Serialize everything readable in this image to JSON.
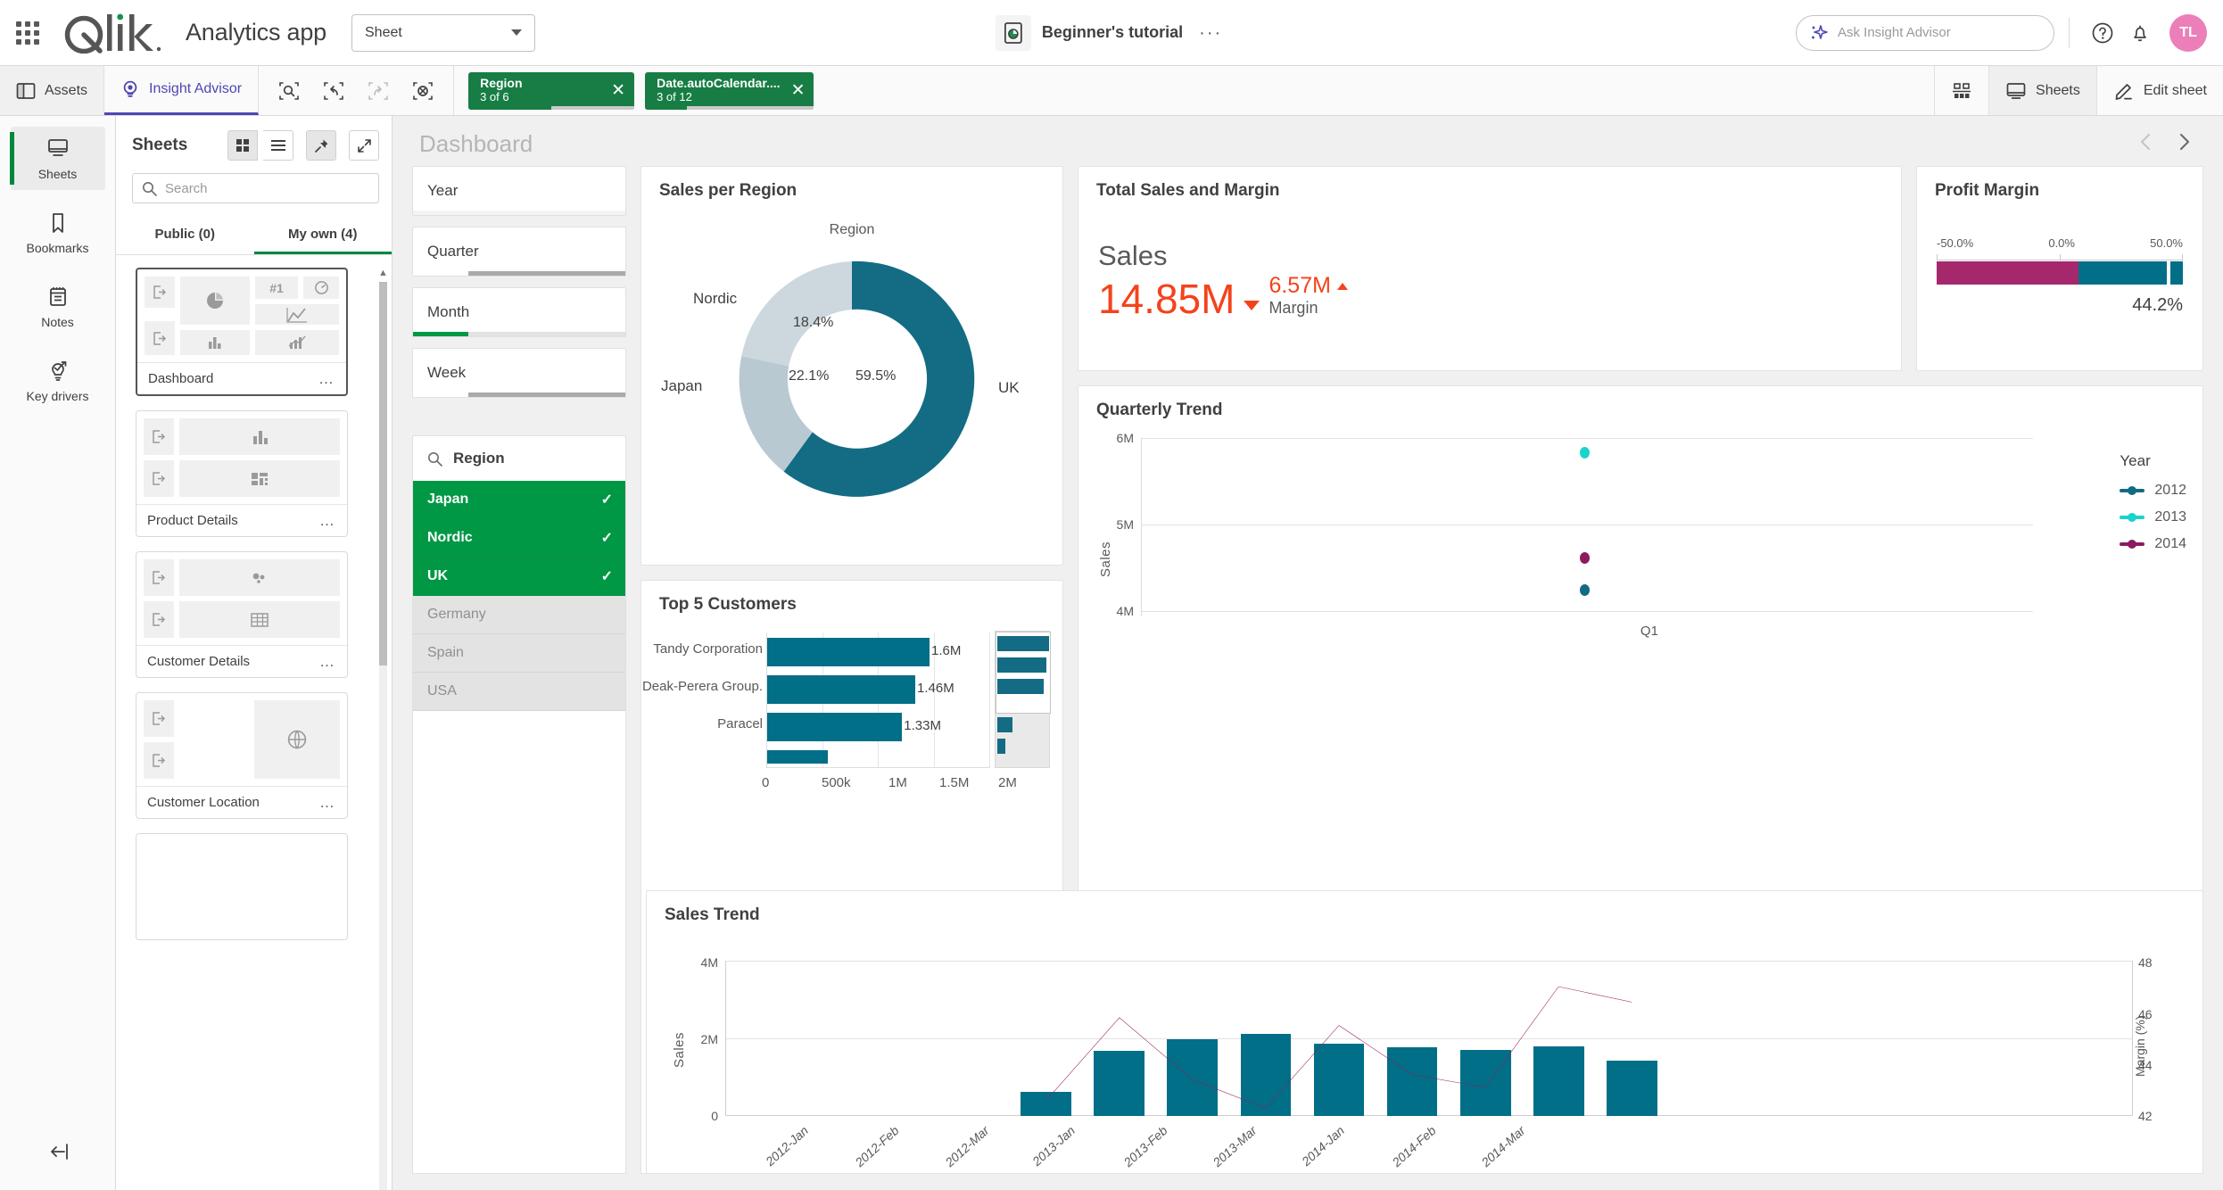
{
  "header": {
    "app_title": "Analytics app",
    "sheet_select_label": "Sheet",
    "doc_name": "Beginner's tutorial",
    "more_label": "···",
    "ask_placeholder": "Ask Insight Advisor",
    "avatar_initials": "TL"
  },
  "toolbar": {
    "assets_label": "Assets",
    "insight_advisor_label": "Insight Advisor",
    "sheets_label": "Sheets",
    "edit_sheet_label": "Edit sheet",
    "chips": [
      {
        "name": "Region",
        "sub": "3 of 6",
        "fill_pct": 50
      },
      {
        "name": "Date.autoCalendar....",
        "sub": "3 of 12",
        "fill_pct": 25
      }
    ]
  },
  "rail": {
    "items": [
      {
        "label": "Sheets",
        "icon": "sheets-icon",
        "active": true
      },
      {
        "label": "Bookmarks",
        "icon": "bookmark-icon",
        "active": false
      },
      {
        "label": "Notes",
        "icon": "notes-icon",
        "active": false
      },
      {
        "label": "Key drivers",
        "icon": "key-drivers-icon",
        "active": false
      }
    ],
    "collapse_label": "collapse-panel-icon"
  },
  "sheets_panel": {
    "title": "Sheets",
    "search_placeholder": "Search",
    "tabs": [
      {
        "label": "Public (0)",
        "active": false
      },
      {
        "label": "My own (4)",
        "active": true
      }
    ],
    "cards": [
      {
        "name": "Dashboard",
        "selected": true
      },
      {
        "name": "Product Details",
        "selected": false
      },
      {
        "name": "Customer Details",
        "selected": false
      },
      {
        "name": "Customer Location",
        "selected": false
      }
    ]
  },
  "sheet": {
    "name": "Dashboard",
    "prev_label": "‹",
    "next_label": "›"
  },
  "filters": [
    {
      "label": "Year",
      "fill_pct": 0,
      "state": "none"
    },
    {
      "label": "Quarter",
      "fill_pct": 26,
      "state": "alt"
    },
    {
      "label": "Month",
      "fill_pct": 26,
      "state": "selected"
    },
    {
      "label": "Week",
      "fill_pct": 26,
      "state": "alt"
    }
  ],
  "listbox": {
    "field": "Region",
    "rows": [
      {
        "value": "Japan",
        "state": "selected"
      },
      {
        "value": "Nordic",
        "state": "selected"
      },
      {
        "value": "UK",
        "state": "selected"
      },
      {
        "value": "Germany",
        "state": "excluded"
      },
      {
        "value": "Spain",
        "state": "excluded"
      },
      {
        "value": "USA",
        "state": "excluded"
      }
    ],
    "check_glyph": "✓"
  },
  "kpi": {
    "title": "Total Sales and Margin",
    "measure_label": "Sales",
    "value": "14.85M",
    "secondary_value": "6.57M",
    "secondary_label": "Margin"
  },
  "gauge": {
    "title": "Profit Margin",
    "ticks": [
      "-50.0%",
      "0.0%",
      "50.0%"
    ],
    "value_label": "44.2%"
  },
  "chart_data": [
    {
      "type": "pie",
      "title": "Sales per Region",
      "dimension_label": "Region",
      "labels": [
        "UK",
        "Japan",
        "Nordic"
      ],
      "values": [
        59.5,
        22.1,
        18.4
      ],
      "value_labels": [
        "59.5%",
        "22.1%",
        "18.4%"
      ],
      "colors": [
        "#136c84",
        "#b9c9d2",
        "#c9d5dc"
      ],
      "legend": "off",
      "donut": true
    },
    {
      "type": "bar",
      "title": "Top 5 Customers",
      "orientation": "horizontal",
      "categories": [
        "Tandy Corporation",
        "Deak-Perera Group.",
        "Paracel",
        ""
      ],
      "values": [
        1600000,
        1460000,
        1330000,
        600000
      ],
      "value_labels": [
        "1.6M",
        "1.46M",
        "1.33M",
        ""
      ],
      "xlabel": "",
      "ylabel": "",
      "xlim": [
        0,
        2200000
      ],
      "xticks": [
        "0",
        "500k",
        "1M",
        "1.5M",
        "2M"
      ],
      "color": "#136c84",
      "grid": true
    },
    {
      "type": "scatter",
      "title": "Quarterly Trend",
      "xlabel": "",
      "ylabel": "Sales",
      "xticks": [
        "Q1"
      ],
      "yticks": [
        "4M",
        "5M",
        "6M"
      ],
      "ylim": [
        4000000,
        6000000
      ],
      "legend_title": "Year",
      "series": [
        {
          "name": "2012",
          "color": "#126b84",
          "x": [
            "Q1"
          ],
          "values": [
            4320000
          ]
        },
        {
          "name": "2013",
          "color": "#19d3cd",
          "x": [
            "Q1"
          ],
          "values": [
            5790000
          ]
        },
        {
          "name": "2014",
          "color": "#8c1b5e",
          "x": [
            "Q1"
          ],
          "values": [
            4630000
          ]
        }
      ]
    },
    {
      "type": "bar",
      "title": "Sales Trend",
      "categories": [
        "2012-Jan",
        "2012-Feb",
        "2012-Mar",
        "2013-Jan",
        "2013-Feb",
        "2013-Mar",
        "2014-Jan",
        "2014-Feb",
        "2014-Mar"
      ],
      "ylabel": "Sales",
      "yticks": [
        "0",
        "2M",
        "4M"
      ],
      "ylim": [
        0,
        4000000
      ],
      "bar_color": "#0d6e87",
      "values": [
        620000,
        1700000,
        1990000,
        2130000,
        1880000,
        1790000,
        1720000,
        1800000,
        1430000
      ],
      "series": [
        {
          "name": "Margin (%)",
          "type": "line",
          "color": "#9b1b60",
          "axis": "right",
          "ylabel": "Margin (%)",
          "yticks": [
            "42",
            "44",
            "46",
            "48"
          ],
          "ylim": [
            42,
            48
          ],
          "values": [
            42.6,
            45.8,
            43.4,
            42.3,
            45.5,
            43.6,
            43.1,
            47.0,
            46.4
          ]
        }
      ]
    }
  ]
}
